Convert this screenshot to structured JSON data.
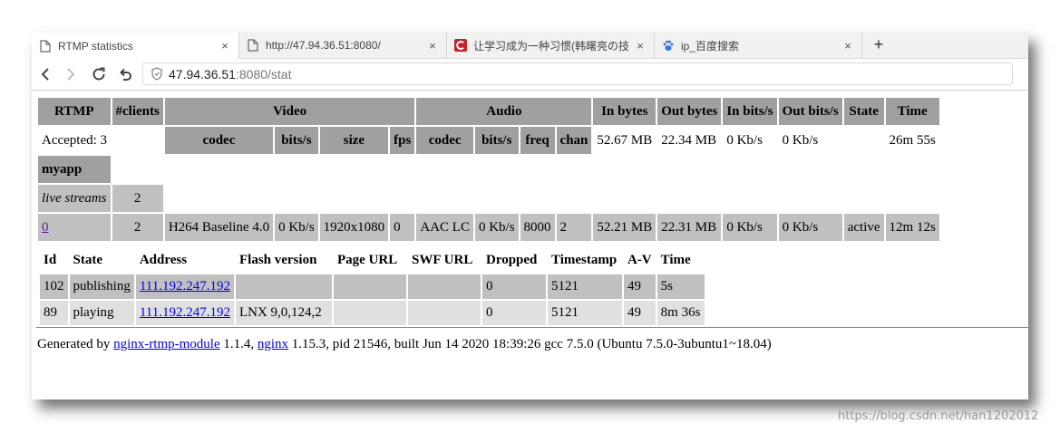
{
  "tabs": [
    {
      "title": "RTMP statistics",
      "icon": "page-icon",
      "active": true
    },
    {
      "title": "http://47.94.36.51:8080/",
      "icon": "page-icon",
      "active": false
    },
    {
      "title": "让学习成为一种习惯(韩曙亮の技",
      "icon": "csdn-logo-icon",
      "active": false
    },
    {
      "title": "ip_百度搜索",
      "icon": "baidu-paw-icon",
      "active": false
    }
  ],
  "close_glyph": "×",
  "newtab_glyph": "+",
  "address": {
    "host": "47.94.36.51",
    "path": ":8080/stat"
  },
  "stat": {
    "headers": {
      "rtmp": "RTMP",
      "clients": "#clients",
      "video": "Video",
      "audio": "Audio",
      "in_bytes": "In bytes",
      "out_bytes": "Out bytes",
      "in_bits": "In bits/s",
      "out_bits": "Out bits/s",
      "state": "State",
      "time": "Time"
    },
    "sub_headers": {
      "v_codec": "codec",
      "v_bits": "bits/s",
      "v_size": "size",
      "v_fps": "fps",
      "a_codec": "codec",
      "a_bits": "bits/s",
      "a_freq": "freq",
      "a_chan": "chan"
    },
    "summary": {
      "accepted": "Accepted: 3",
      "in_bytes": "52.67 MB",
      "out_bytes": "22.34 MB",
      "in_bits": "0 Kb/s",
      "out_bits": "0 Kb/s",
      "time": "26m 55s"
    },
    "app_name": "myapp",
    "live_label": "live streams",
    "live_count": "2",
    "stream": {
      "name": "0",
      "clients": "2",
      "v_codec": "H264 Baseline 4.0",
      "v_bits": "0 Kb/s",
      "v_size": "1920x1080",
      "v_fps": "0",
      "a_codec": "AAC LC",
      "a_bits": "0 Kb/s",
      "a_freq": "8000",
      "a_chan": "2",
      "in_bytes": "52.21 MB",
      "out_bytes": "22.31 MB",
      "in_bits": "0 Kb/s",
      "out_bits": "0 Kb/s",
      "state": "active",
      "time": "12m 12s"
    },
    "client_headers": [
      "Id",
      "State",
      "Address",
      "Flash version",
      "Page URL",
      "SWF URL",
      "Dropped",
      "Timestamp",
      "A-V",
      "Time"
    ],
    "clients": [
      {
        "id": "102",
        "state": "publishing",
        "address": "111.192.247.192",
        "flash": "",
        "page_url": "",
        "swf_url": "",
        "dropped": "0",
        "timestamp": "5121",
        "av": "49",
        "time": "5s"
      },
      {
        "id": "89",
        "state": "playing",
        "address": "111.192.247.192",
        "flash": "LNX 9,0,124,2",
        "page_url": "",
        "swf_url": "",
        "dropped": "0",
        "timestamp": "5121",
        "av": "49",
        "time": "8m 36s"
      }
    ]
  },
  "footer": {
    "prefix": "Generated by ",
    "module_link": "nginx-rtmp-module",
    "module_version": " 1.1.4, ",
    "nginx_link": "nginx",
    "rest": " 1.15.3, pid 21546, built Jun 14 2020 18:39:26 gcc 7.5.0 (Ubuntu 7.5.0-3ubuntu1~18.04)"
  },
  "watermark": "https://blog.csdn.net/han1202012",
  "colors": {
    "header": "#a0a0a0",
    "row_dark": "#c0c0c0",
    "row_light": "#e0e0e0",
    "csdn_red": "#c9202a",
    "baidu_blue": "#3a74e8",
    "link": "#0000ee"
  }
}
